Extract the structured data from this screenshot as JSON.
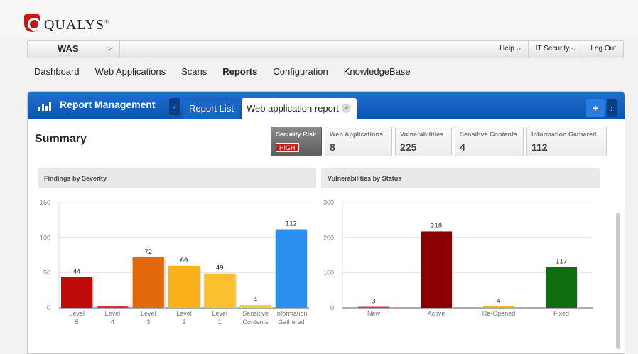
{
  "logo": {
    "text": "QUALYS",
    "mark": "®"
  },
  "topbar": {
    "app": "WAS",
    "help": "Help",
    "module": "IT Security",
    "logout": "Log Out"
  },
  "nav": [
    "Dashboard",
    "Web Applications",
    "Scans",
    "Reports",
    "Configuration",
    "KnowledgeBase"
  ],
  "nav_active": "Reports",
  "panel": {
    "title": "Report Management",
    "tab_list": "Report List",
    "tab_report": "Web application report",
    "plus": "+",
    "close": "×"
  },
  "summary": {
    "title": "Summary",
    "risk_label": "Security Risk",
    "risk_value": "HIGH",
    "stats": [
      {
        "label": "Web Applications",
        "value": "8"
      },
      {
        "label": "Vulnerabilities",
        "value": "225"
      },
      {
        "label": "Sensitive Contents",
        "value": "4"
      },
      {
        "label": "Information Gathered",
        "value": "112"
      }
    ]
  },
  "colors": {
    "header_blue": "#0d55b0",
    "risk_red": "#c8161d"
  },
  "chart_data": [
    {
      "type": "bar",
      "title": "Findings by Severity",
      "categories": [
        "Level 5",
        "Level 4",
        "Level 3",
        "Level 2",
        "Level 1",
        "Sensitive Contents",
        "Information Gathered"
      ],
      "values": [
        44,
        2,
        72,
        60,
        49,
        4,
        112
      ],
      "data_labels": [
        "44",
        "",
        "72",
        "60",
        "49",
        "4",
        "112"
      ],
      "colors": [
        "#c00b0b",
        "#e02a2a",
        "#e06a0c",
        "#fbb21a",
        "#fbc02d",
        "#f3d12c",
        "#2b8ff0"
      ],
      "ylim": [
        0,
        150
      ],
      "yticks": [
        0,
        50,
        100,
        150
      ]
    },
    {
      "type": "bar",
      "title": "Vulnerabilities by Status",
      "categories": [
        "New",
        "Active",
        "Re-Opened",
        "Fixed"
      ],
      "values": [
        3,
        218,
        4,
        117
      ],
      "data_labels": [
        "3",
        "218",
        "4",
        "117"
      ],
      "colors": [
        "#e03030",
        "#8b0000",
        "#f0b020",
        "#0f6e0f"
      ],
      "ylim": [
        0,
        300
      ],
      "yticks": [
        0,
        100,
        200,
        300
      ]
    }
  ]
}
